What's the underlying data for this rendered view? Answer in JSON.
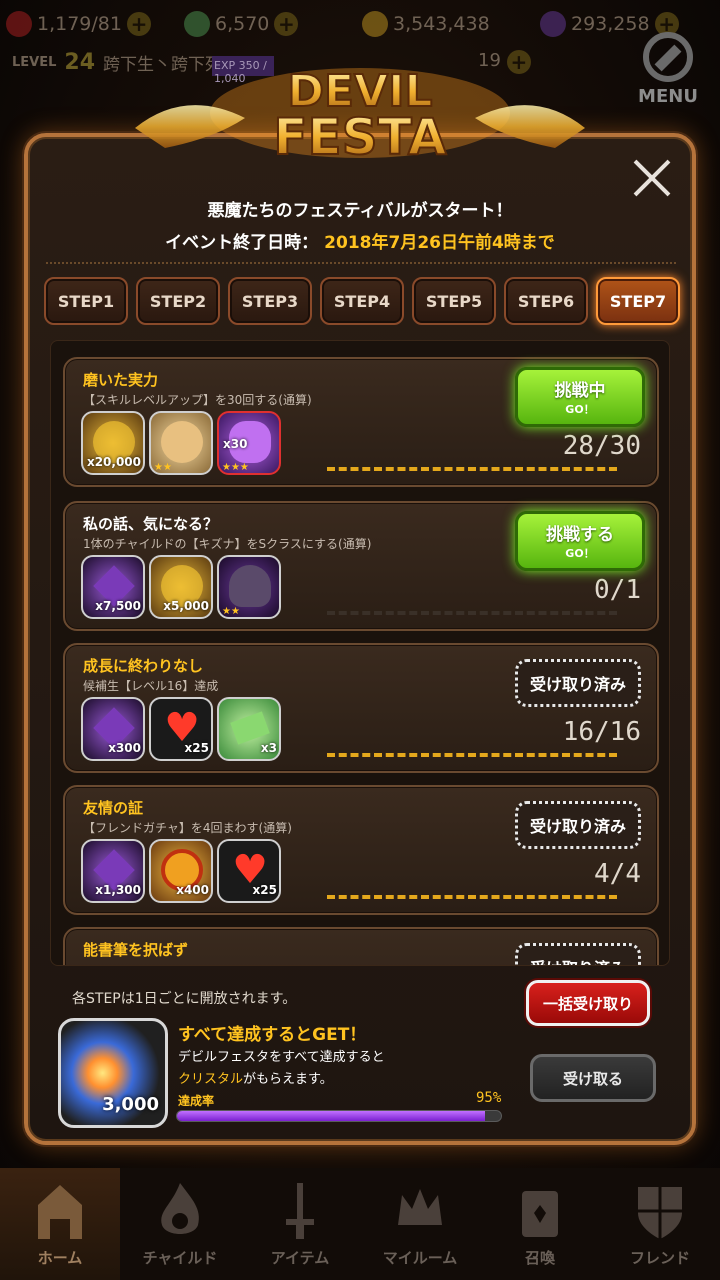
{
  "topbar": {
    "resources": [
      {
        "icon": "heart-icon",
        "value": "1,179/81",
        "color": "#b52020"
      },
      {
        "icon": "gem-icon",
        "value": "6,570",
        "color": "#4a8a4a"
      },
      {
        "icon": "coin-icon",
        "value": "3,543,438",
        "color": "#b58a20"
      },
      {
        "icon": "dark-crystal-icon",
        "value": "293,258",
        "color": "#5a3a7a"
      }
    ],
    "level_label": "LEVEL",
    "level": "24",
    "player_name": "跨下生丶跨下死",
    "exp": "EXP 350 / 1,040",
    "friend_hearts": "19",
    "menu_label": "MENU"
  },
  "event": {
    "logo_line1": "DEVIL",
    "logo_line2": "FESTA",
    "intro": "悪魔たちのフェスティバルがスタート！",
    "deadline_label": "イベント終了日時：",
    "deadline_value": "2018年7月26日午前4時まで",
    "close_icon": "close-icon"
  },
  "tabs": [
    "STEP1",
    "STEP2",
    "STEP3",
    "STEP4",
    "STEP5",
    "STEP6",
    "STEP7"
  ],
  "active_tab": 6,
  "missions": [
    {
      "title": "磨いた実力",
      "desc": "【スキルレベルアップ】を30回する(通算)",
      "rewards": [
        {
          "icon": "gold-coins-icon",
          "qty": "x20,000",
          "stars": ""
        },
        {
          "icon": "yellow-creature-icon",
          "qty": "",
          "stars": "★★"
        },
        {
          "icon": "purple-ghost-icon",
          "qty": "x30",
          "stars": "★★★"
        }
      ],
      "progress": "28/30",
      "progress_fraction": 0.93,
      "button": {
        "type": "challenge",
        "main": "挑戦中",
        "sub": "GO！"
      }
    },
    {
      "title": "私の話、気になる？",
      "desc": "1体のチャイルドの【キズナ】をSクラスにする(通算)",
      "rewards": [
        {
          "icon": "purple-crystal-icon",
          "qty": "x7,500",
          "stars": ""
        },
        {
          "icon": "gold-coins-icon",
          "qty": "x5,000",
          "stars": ""
        },
        {
          "icon": "dark-child-icon",
          "qty": "",
          "stars": "★★"
        }
      ],
      "progress": "0/1",
      "progress_fraction": 0,
      "button": {
        "type": "challenge",
        "main": "挑戦する",
        "sub": "GO！"
      }
    },
    {
      "title": "成長に終わりなし",
      "desc": "候補生【レベル16】達成",
      "rewards": [
        {
          "icon": "purple-crystal-icon",
          "qty": "x300",
          "stars": ""
        },
        {
          "icon": "heart-icon",
          "qty": "x25",
          "stars": ""
        },
        {
          "icon": "ticket-icon",
          "qty": "x3",
          "stars": ""
        }
      ],
      "progress": "16/16",
      "progress_fraction": 1,
      "button": {
        "type": "claimed",
        "main": "受け取り済み"
      }
    },
    {
      "title": "友情の証",
      "desc": "【フレンドガチャ】を4回まわす(通算)",
      "rewards": [
        {
          "icon": "purple-crystal-icon",
          "qty": "x1,300",
          "stars": ""
        },
        {
          "icon": "medal-icon",
          "qty": "x400",
          "stars": ""
        },
        {
          "icon": "heart-icon",
          "qty": "x25",
          "stars": ""
        }
      ],
      "progress": "4/4",
      "progress_fraction": 1,
      "button": {
        "type": "claimed",
        "main": "受け取り済み"
      }
    },
    {
      "title": "能書筆を択ばず",
      "desc": "",
      "rewards": [],
      "progress": "",
      "progress_fraction": 0,
      "button": {
        "type": "claimed",
        "main": "受け取り済み"
      }
    }
  ],
  "footer": {
    "unlock_note": "各STEPは1日ごとに開放されます。",
    "crystal_qty": "3,000",
    "get_title": "すべて達成するとGET！",
    "get_desc1": "デビルフェスタをすべて達成すると",
    "get_desc2_hl": "クリスタル",
    "get_desc2_rest": "がもらえます。",
    "rate_label": "達成率",
    "rate_value": "95%",
    "rate_fraction": 0.95,
    "bulk_button": "一括受け取り",
    "receive_button": "受け取る"
  },
  "nav": [
    {
      "label": "ホーム",
      "icon": "home-icon",
      "active": true
    },
    {
      "label": "チャイルド",
      "icon": "child-flame-icon",
      "active": false
    },
    {
      "label": "アイテム",
      "icon": "item-sword-icon",
      "active": false
    },
    {
      "label": "マイルーム",
      "icon": "crown-icon",
      "active": false
    },
    {
      "label": "召喚",
      "icon": "summon-card-icon",
      "active": false
    },
    {
      "label": "フレンド",
      "icon": "shield-icon",
      "active": false
    }
  ]
}
